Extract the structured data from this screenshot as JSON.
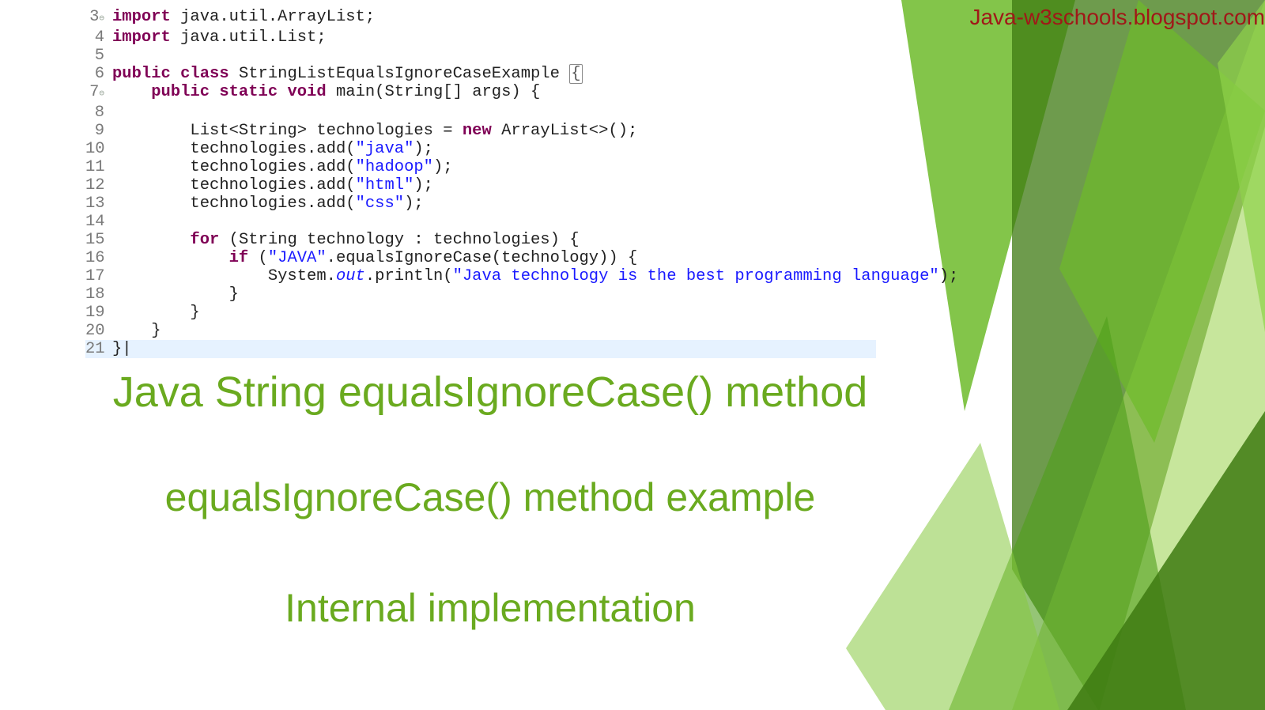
{
  "watermark": "Java-w3schools.blogspot.com",
  "code": {
    "lines": [
      {
        "n": "3",
        "mark": "⊖",
        "tokens": [
          [
            "kw",
            "import "
          ],
          [
            "plain",
            "java.util.ArrayList;"
          ]
        ]
      },
      {
        "n": "4",
        "tokens": [
          [
            "kw",
            "import "
          ],
          [
            "plain",
            "java.util.List;"
          ]
        ]
      },
      {
        "n": "5",
        "tokens": [
          [
            "plain",
            ""
          ]
        ]
      },
      {
        "n": "6",
        "tokens": [
          [
            "kw",
            "public class "
          ],
          [
            "plain",
            "StringListEqualsIgnoreCaseExample "
          ],
          [
            "bracket",
            "{"
          ]
        ]
      },
      {
        "n": "7",
        "mark": "⊖",
        "tokens": [
          [
            "plain",
            "    "
          ],
          [
            "kw",
            "public static void "
          ],
          [
            "plain",
            "main(String[] args) {"
          ]
        ]
      },
      {
        "n": "8",
        "tokens": [
          [
            "plain",
            ""
          ]
        ]
      },
      {
        "n": "9",
        "tokens": [
          [
            "plain",
            "        List<String> technologies = "
          ],
          [
            "kw",
            "new "
          ],
          [
            "plain",
            "ArrayList<>();"
          ]
        ]
      },
      {
        "n": "10",
        "tokens": [
          [
            "plain",
            "        technologies.add("
          ],
          [
            "str",
            "\"java\""
          ],
          [
            "plain",
            ");"
          ]
        ]
      },
      {
        "n": "11",
        "tokens": [
          [
            "plain",
            "        technologies.add("
          ],
          [
            "str",
            "\"hadoop\""
          ],
          [
            "plain",
            ");"
          ]
        ]
      },
      {
        "n": "12",
        "tokens": [
          [
            "plain",
            "        technologies.add("
          ],
          [
            "str",
            "\"html\""
          ],
          [
            "plain",
            ");"
          ]
        ]
      },
      {
        "n": "13",
        "tokens": [
          [
            "plain",
            "        technologies.add("
          ],
          [
            "str",
            "\"css\""
          ],
          [
            "plain",
            ");"
          ]
        ]
      },
      {
        "n": "14",
        "tokens": [
          [
            "plain",
            ""
          ]
        ]
      },
      {
        "n": "15",
        "tokens": [
          [
            "plain",
            "        "
          ],
          [
            "kw",
            "for "
          ],
          [
            "plain",
            "(String technology : technologies) {"
          ]
        ]
      },
      {
        "n": "16",
        "tokens": [
          [
            "plain",
            "            "
          ],
          [
            "kw",
            "if "
          ],
          [
            "plain",
            "("
          ],
          [
            "str",
            "\"JAVA\""
          ],
          [
            "plain",
            ".equalsIgnoreCase(technology)) {"
          ]
        ]
      },
      {
        "n": "17",
        "tokens": [
          [
            "plain",
            "                System."
          ],
          [
            "ital",
            "out"
          ],
          [
            "plain",
            ".println("
          ],
          [
            "str",
            "\"Java technology is the best programming language\""
          ],
          [
            "plain",
            ");"
          ]
        ]
      },
      {
        "n": "18",
        "tokens": [
          [
            "plain",
            "            }"
          ]
        ]
      },
      {
        "n": "19",
        "tokens": [
          [
            "plain",
            "        }"
          ]
        ]
      },
      {
        "n": "20",
        "tokens": [
          [
            "plain",
            "    }"
          ]
        ]
      },
      {
        "n": "21",
        "hl": true,
        "tokens": [
          [
            "plain",
            "}|"
          ]
        ]
      }
    ]
  },
  "headings": {
    "h1": "Java String equalsIgnoreCase() method",
    "h2": "equalsIgnoreCase() method example",
    "h3": "Internal implementation"
  },
  "colors": {
    "accent": "#6aaa1f",
    "green_dark": "#3e7a12",
    "green_mid": "#6dbb2a",
    "green_light": "#a2d65a"
  }
}
